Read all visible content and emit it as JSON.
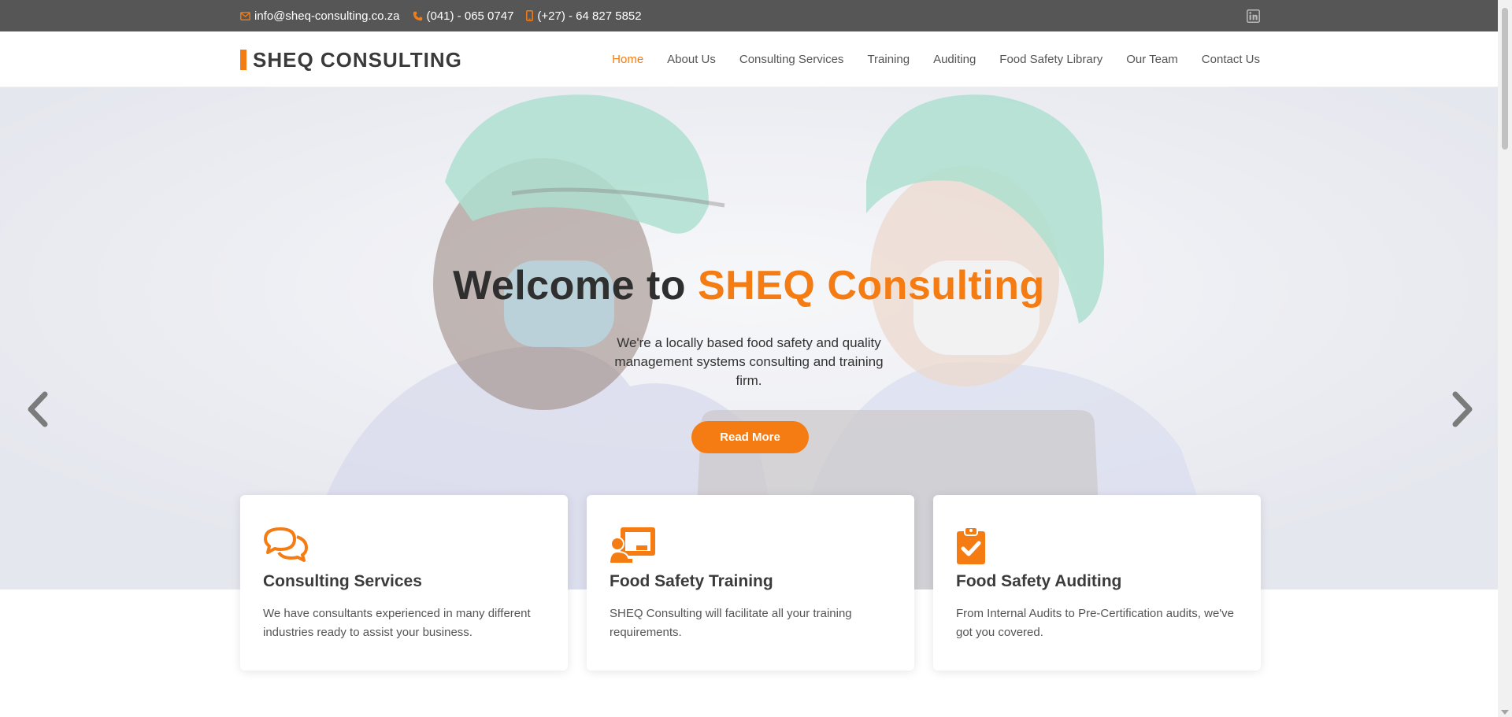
{
  "topbar": {
    "email": "info@sheq-consulting.co.za",
    "phone": "(041) - 065 0747",
    "mobile": "(+27) - 64 827 5852",
    "social_icon": "linkedin-icon"
  },
  "header": {
    "logo_text": "SHEQ CONSULTING",
    "nav": [
      {
        "label": "Home",
        "active": true
      },
      {
        "label": "About Us"
      },
      {
        "label": "Consulting Services"
      },
      {
        "label": "Training"
      },
      {
        "label": "Auditing"
      },
      {
        "label": "Food Safety Library"
      },
      {
        "label": "Our Team"
      },
      {
        "label": "Contact Us"
      }
    ]
  },
  "hero": {
    "title_prefix": "Welcome to ",
    "title_accent": "SHEQ Consulting",
    "lead": "We're a locally based food safety and quality management systems consulting and training firm.",
    "button": "Read More"
  },
  "cards": [
    {
      "icon": "chat-bubbles-icon",
      "title": "Consulting Services",
      "text": "We have consultants experienced in many different industries ready to assist your business."
    },
    {
      "icon": "presenter-board-icon",
      "title": "Food Safety Training",
      "text": "SHEQ Consulting will facilitate all your training requirements."
    },
    {
      "icon": "clipboard-check-icon",
      "title": "Food Safety Auditing",
      "text": "From Internal Audits to Pre-Certification audits, we've got you covered."
    }
  ],
  "colors": {
    "accent": "#f57c12",
    "topbar": "#565656",
    "heading": "#2f2f2f"
  }
}
